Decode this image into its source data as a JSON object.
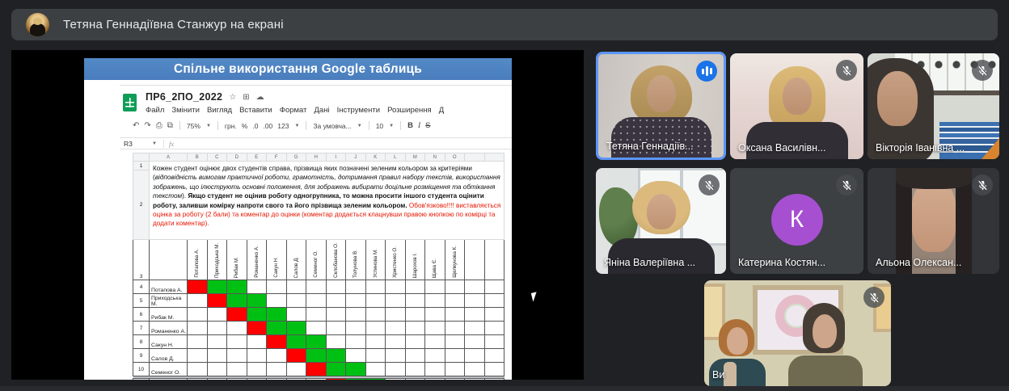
{
  "banner": {
    "presenter_text": "Тетяна Геннадіївна Станжур на екрані"
  },
  "presentation": {
    "slide_title": "Спільне використання Google таблиць",
    "sheet": {
      "title": "ПР6_2ПО_2022",
      "title_icons": [
        "star-icon",
        "move-icon",
        "cloud-icon"
      ],
      "menu": [
        "Файл",
        "Змінити",
        "Вигляд",
        "Вставити",
        "Формат",
        "Дані",
        "Інструменти",
        "Розширення",
        "Д"
      ],
      "toolbar": {
        "zoom": "75%",
        "currency": "грн.",
        "percent": "%",
        "dec_decrease": ".0",
        "dec_increase": ".00",
        "more_formats": "123",
        "cond_format": "За умовча...",
        "font_size": "10",
        "bold": "B",
        "italic": "I",
        "strikethrough": "S"
      },
      "name_box": "R3",
      "formula_label": "fx",
      "col_headers": [
        "A",
        "B",
        "C",
        "D",
        "E",
        "F",
        "G",
        "H",
        "I",
        "J",
        "K",
        "L",
        "M",
        "N",
        "O"
      ],
      "instructions": {
        "part1": "Кожен студент оцінює двох студентів справа, прізвища яких позначені зеленим кольором за критеріями (",
        "part2_italic": "відповідність вимогам практичної роботи, грамотність, дотримання правил набору текстів, використання зображень, що ілюструють основні положення, для зображень вибирати доцільне розміщення та обтікання текстом",
        "part3": "). ",
        "part4_bold": "Якщо студент не оцінив роботу одногрупника, то можна просити іншого студента оцінити роботу, заливши комірку напроти свого та його прізвища зеленим кольором.",
        "part5_red": " Обов'язково!!!! виставляється оцінка за роботу (2 бали) та коментар до оцінки (коментар додається клацнувши правою кнопкою по комірці  та додати коментар)."
      },
      "row_labels": {
        "row1": "1",
        "row2": "2",
        "row3": "3"
      },
      "students": [
        "Потапова А.",
        "Приходська М.",
        "Рибак М.",
        "Романенко А.",
        "Сакун Н.",
        "Салов Д.",
        "Семеног О.",
        "Склобанова О.",
        "Толунова В.",
        "Устинова М.",
        "Христенко О.",
        "Шарохов І.",
        "Щава Є.",
        "Щелкунова К."
      ],
      "matrix_rows": [
        {
          "num": "4",
          "name": "Потапова А.",
          "red": 1,
          "greens": [
            2,
            3
          ]
        },
        {
          "num": "5",
          "name": "Приходська М.",
          "red": 2,
          "greens": [
            3,
            4
          ]
        },
        {
          "num": "6",
          "name": "Рибак М.",
          "red": 3,
          "greens": [
            4,
            5
          ]
        },
        {
          "num": "7",
          "name": "Романенко А.",
          "red": 4,
          "greens": [
            5,
            6
          ]
        },
        {
          "num": "8",
          "name": "Сакун Н.",
          "red": 5,
          "greens": [
            6,
            7
          ]
        },
        {
          "num": "9",
          "name": "Салов Д.",
          "red": 6,
          "greens": [
            7,
            8
          ]
        },
        {
          "num": "10",
          "name": "Семеног О.",
          "red": 7,
          "greens": [
            8,
            9
          ]
        }
      ],
      "partial_row": {
        "red": 8,
        "greens": [
          9,
          10
        ]
      },
      "colors": {
        "cell_red": "#fe0000",
        "cell_green": "#00c014",
        "banner_blue": "#4a7dbd"
      }
    }
  },
  "participants": [
    {
      "label": "Тетяна Геннадіїв...",
      "state": "speaking",
      "icon": "speaking-indicator"
    },
    {
      "label": "Оксана Василівн...",
      "state": "muted",
      "icon": "mic-off-icon"
    },
    {
      "label": "Вікторія Іванівна ...",
      "state": "muted",
      "icon": "mic-off-icon"
    },
    {
      "label": "Яніна Валеріївна ...",
      "state": "muted",
      "icon": "mic-off-icon"
    },
    {
      "label": "Катерина Костян...",
      "state": "muted",
      "icon": "mic-off-icon",
      "avatar_letter": "К",
      "avatar_color": "#a64fd0"
    },
    {
      "label": "Альона Олексан...",
      "state": "muted",
      "icon": "mic-off-icon"
    },
    {
      "label": "Ви",
      "state": "muted",
      "icon": "mic-off-icon"
    }
  ]
}
